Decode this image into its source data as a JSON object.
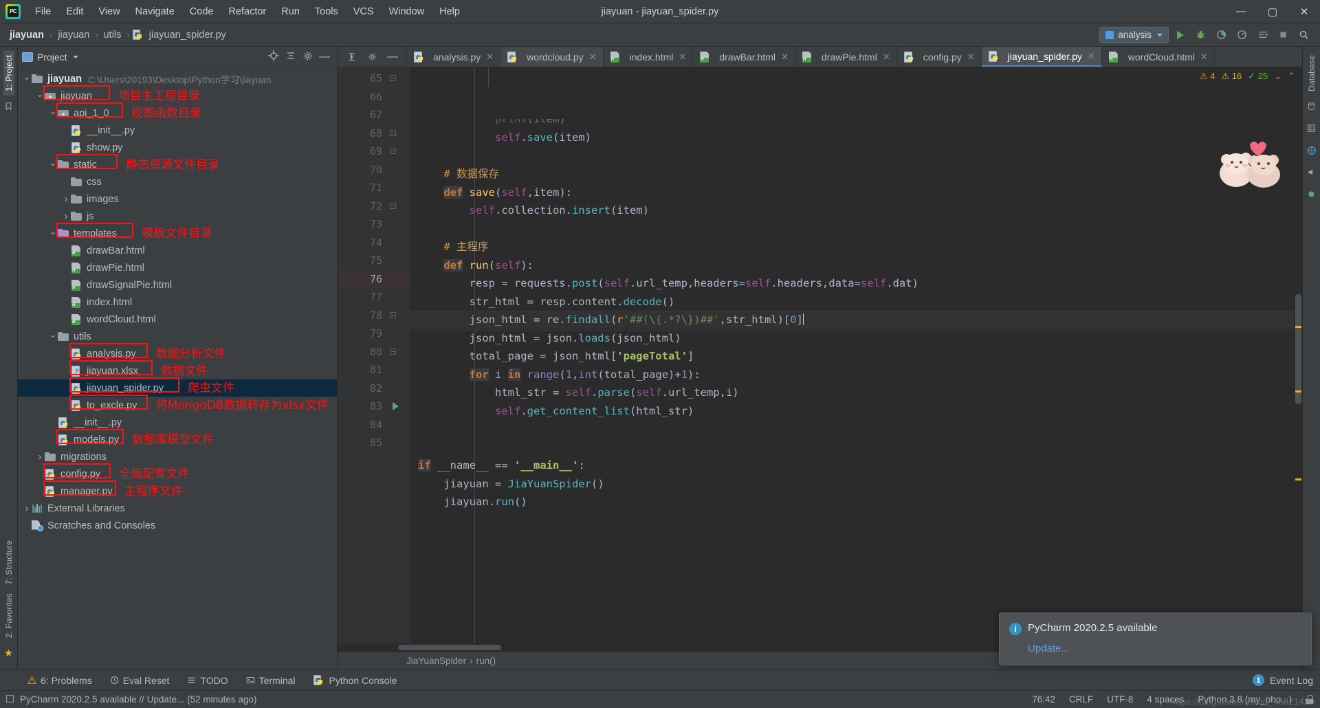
{
  "window": {
    "title": "jiayuan - jiayuan_spider.py",
    "minimize": "—",
    "maximize": "▢",
    "close": "✕"
  },
  "menu": [
    "File",
    "Edit",
    "View",
    "Navigate",
    "Code",
    "Refactor",
    "Run",
    "Tools",
    "VCS",
    "Window",
    "Help"
  ],
  "breadcrumb": {
    "items": [
      "jiayuan",
      "jiayuan",
      "utils",
      "jiayuan_spider.py"
    ],
    "separator": "›"
  },
  "toolbar": {
    "run_config": "analysis",
    "run_label": "Run",
    "debug_label": "Debug",
    "coverage_label": "Run with Coverage",
    "profile_label": "Profile",
    "stop_label": "Stop",
    "search_label": "Search Everywhere"
  },
  "left_rail": {
    "project_label": "1: Project",
    "structure_label": "7: Structure",
    "favorites_label": "2: Favorites"
  },
  "right_rail": {
    "database_label": "Database"
  },
  "project_panel": {
    "title": "Project",
    "root": {
      "label": "jiayuan",
      "path": "C:\\Users\\20193\\Desktop\\Python学习\\jiayuan"
    },
    "tree": [
      {
        "label": "jiayuan",
        "icon": "folder-module",
        "indent": 1,
        "arrow": "down",
        "annot": "项目主工程目录",
        "boxed": true
      },
      {
        "label": "api_1_0",
        "icon": "folder-module",
        "indent": 2,
        "arrow": "down",
        "annot": "视图函数目录",
        "boxed": true
      },
      {
        "label": "__init__.py",
        "icon": "python",
        "indent": 3,
        "arrow": "none"
      },
      {
        "label": "show.py",
        "icon": "python",
        "indent": 3,
        "arrow": "none"
      },
      {
        "label": "static",
        "icon": "folder",
        "indent": 2,
        "arrow": "down",
        "annot": "静态资源文件目录",
        "boxed": true
      },
      {
        "label": "css",
        "icon": "folder",
        "indent": 3,
        "arrow": "none"
      },
      {
        "label": "images",
        "icon": "folder",
        "indent": 3,
        "arrow": "right"
      },
      {
        "label": "js",
        "icon": "folder",
        "indent": 3,
        "arrow": "right"
      },
      {
        "label": "templates",
        "icon": "folder-pink",
        "indent": 2,
        "arrow": "down",
        "annot": "模板文件目录",
        "boxed": true
      },
      {
        "label": "drawBar.html",
        "icon": "html",
        "indent": 3,
        "arrow": "none"
      },
      {
        "label": "drawPie.html",
        "icon": "html",
        "indent": 3,
        "arrow": "none"
      },
      {
        "label": "drawSignalPie.html",
        "icon": "html",
        "indent": 3,
        "arrow": "none"
      },
      {
        "label": "index.html",
        "icon": "html",
        "indent": 3,
        "arrow": "none"
      },
      {
        "label": "wordCloud.html",
        "icon": "html",
        "indent": 3,
        "arrow": "none"
      },
      {
        "label": "utils",
        "icon": "folder",
        "indent": 2,
        "arrow": "down"
      },
      {
        "label": "analysis.py",
        "icon": "python",
        "indent": 3,
        "arrow": "none",
        "annot": "数据分析文件",
        "boxed": true
      },
      {
        "label": "jiayuan.xlsx",
        "icon": "unknown",
        "indent": 3,
        "arrow": "none",
        "annot": "数据文件",
        "boxed": true
      },
      {
        "label": "jiayuan_spider.py",
        "icon": "python",
        "indent": 3,
        "arrow": "none",
        "annot": "爬虫文件",
        "boxed": true,
        "selected": true
      },
      {
        "label": "to_excle.py",
        "icon": "python",
        "indent": 3,
        "arrow": "none",
        "annot": "将MongoDB数据转存为xlsx文件",
        "boxed": true
      },
      {
        "label": "__init__.py",
        "icon": "python",
        "indent": 2,
        "arrow": "none"
      },
      {
        "label": "models.py",
        "icon": "python",
        "indent": 2,
        "arrow": "none",
        "annot": "数据库模型文件",
        "boxed": true
      },
      {
        "label": "migrations",
        "icon": "folder",
        "indent": 1,
        "arrow": "right"
      },
      {
        "label": "config.py",
        "icon": "python",
        "indent": 1,
        "arrow": "none",
        "annot": "全局配置文件",
        "boxed": true
      },
      {
        "label": "manager.py",
        "icon": "python",
        "indent": 1,
        "arrow": "none",
        "annot": "主程序文件",
        "boxed": true
      },
      {
        "label": "External Libraries",
        "icon": "library",
        "indent": 0,
        "arrow": "right"
      },
      {
        "label": "Scratches and Consoles",
        "icon": "scratch",
        "indent": 0,
        "arrow": "none"
      }
    ]
  },
  "editor_tabs": [
    {
      "label": "analysis.py",
      "icon": "python",
      "active": false
    },
    {
      "label": "wordcloud.py",
      "icon": "python",
      "active": false,
      "hover": true
    },
    {
      "label": "index.html",
      "icon": "html",
      "active": false
    },
    {
      "label": "drawBar.html",
      "icon": "html",
      "active": false
    },
    {
      "label": "drawPie.html",
      "icon": "html",
      "active": false
    },
    {
      "label": "config.py",
      "icon": "python",
      "active": false
    },
    {
      "label": "jiayuan_spider.py",
      "icon": "python",
      "active": true
    },
    {
      "label": "wordCloud.html",
      "icon": "html",
      "active": false
    }
  ],
  "inspections": {
    "warnings": "4",
    "weak_warnings": "16",
    "typos": "25"
  },
  "editor": {
    "first_line": 64,
    "current_line": 76,
    "lines": [
      {
        "n": 65,
        "fold": true
      },
      {
        "n": 66
      },
      {
        "n": 67
      },
      {
        "n": 68,
        "fold": true
      },
      {
        "n": 69,
        "fold": true
      },
      {
        "n": 70
      },
      {
        "n": 71
      },
      {
        "n": 72,
        "fold": true
      },
      {
        "n": 73
      },
      {
        "n": 74
      },
      {
        "n": 75
      },
      {
        "n": 76,
        "current": true
      },
      {
        "n": 77
      },
      {
        "n": 78,
        "fold": true
      },
      {
        "n": 79
      },
      {
        "n": 80,
        "fold": true
      },
      {
        "n": 81
      },
      {
        "n": 82
      },
      {
        "n": 83,
        "run": true
      },
      {
        "n": 84
      },
      {
        "n": 85
      }
    ],
    "code": [
      "            print(item)",
      "            self.save(item)",
      "",
      "    # 数据保存",
      "    def save(self,item):",
      "        self.collection.insert(item)",
      "",
      "    # 主程序",
      "    def run(self):",
      "        resp = requests.post(self.url_temp,headers=self.headers,data=self.dat)",
      "        str_html = resp.content.decode()",
      "        json_html = re.findall(r'##(\\{.*?\\})##',str_html)[0]",
      "        json_html = json.loads(json_html)",
      "        total_page = json_html['pageTotal']",
      "        for i in range(1,int(total_page)+1):",
      "            html_str = self.parse(self.url_temp,i)",
      "            self.get_content_list(html_str)",
      "",
      "",
      "if __name__ == '__main__':",
      "    jiayuan = JiaYuanSpider()",
      "    jiayuan.run()"
    ],
    "breadcrumb": {
      "class": "JiaYuanSpider",
      "method": "run()",
      "separator": "›"
    }
  },
  "notification": {
    "title": "PyCharm 2020.2.5 available",
    "link": "Update..."
  },
  "bottom_bar": {
    "items": [
      {
        "label": "6: Problems",
        "icon": "warning-icon"
      },
      {
        "label": "Eval Reset",
        "icon": "clock-icon"
      },
      {
        "label": "TODO",
        "icon": "list-icon"
      },
      {
        "label": "Terminal",
        "icon": "terminal-icon"
      },
      {
        "label": "Python Console",
        "icon": "python-icon"
      }
    ],
    "event_log": "Event Log",
    "event_count": "1"
  },
  "status_bar": {
    "message": "PyCharm 2020.2.5 available // Update... (52 minutes ago)",
    "caret": "76:42",
    "line_sep": "CRLF",
    "encoding": "UTF-8",
    "indent": "4 spaces",
    "interpreter": "Python 3.8 (my_pho...)",
    "watermark": "https://blog.csdn.net/qq_45821420"
  },
  "colors": {
    "accent_blue": "#4a88c7",
    "annotation_red": "#ff1111",
    "selection_blue": "#0d293e",
    "keyword_orange": "#cc7832",
    "string_green": "#6a8759",
    "number_blue": "#6897bb",
    "panel_bg": "#3c3f41",
    "editor_bg": "#2b2b2b"
  }
}
